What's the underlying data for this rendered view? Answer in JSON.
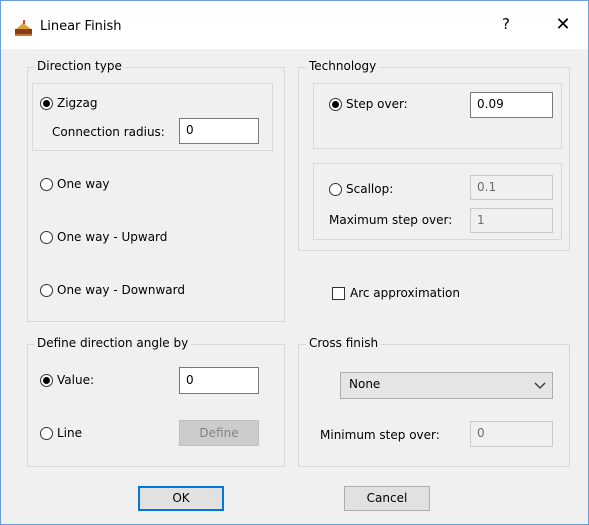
{
  "window": {
    "title": "Linear Finish",
    "help_label": "?",
    "close_label": "✕",
    "app_icon": "cake-icon"
  },
  "direction_type": {
    "legend": "Direction type",
    "zigzag_label": "Zigzag",
    "connection_radius_label": "Connection radius:",
    "connection_radius_value": "0",
    "one_way_label": "One way",
    "one_way_upward_label": "One way - Upward",
    "one_way_downward_label": "One way - Downward",
    "selected": "Zigzag"
  },
  "technology": {
    "legend": "Technology",
    "step_over_label": "Step over:",
    "step_over_value": "0.09",
    "scallop_label": "Scallop:",
    "scallop_value": "0.1",
    "max_step_over_label": "Maximum step over:",
    "max_step_over_value": "1",
    "selected": "Step over:"
  },
  "arc_approximation": {
    "label": "Arc approximation",
    "checked": false
  },
  "define_angle": {
    "legend": "Define direction angle by",
    "value_label": "Value:",
    "value": "0",
    "line_label": "Line",
    "define_button": "Define",
    "selected": "Value:"
  },
  "cross_finish": {
    "legend": "Cross finish",
    "selected_option": "None",
    "min_step_over_label": "Minimum step over:",
    "min_step_over_value": "0"
  },
  "buttons": {
    "ok": "OK",
    "cancel": "Cancel"
  },
  "colors": {
    "dialog_bg": "#f0f0f0",
    "accent": "#0078d7",
    "border": "#6b9ed6"
  }
}
